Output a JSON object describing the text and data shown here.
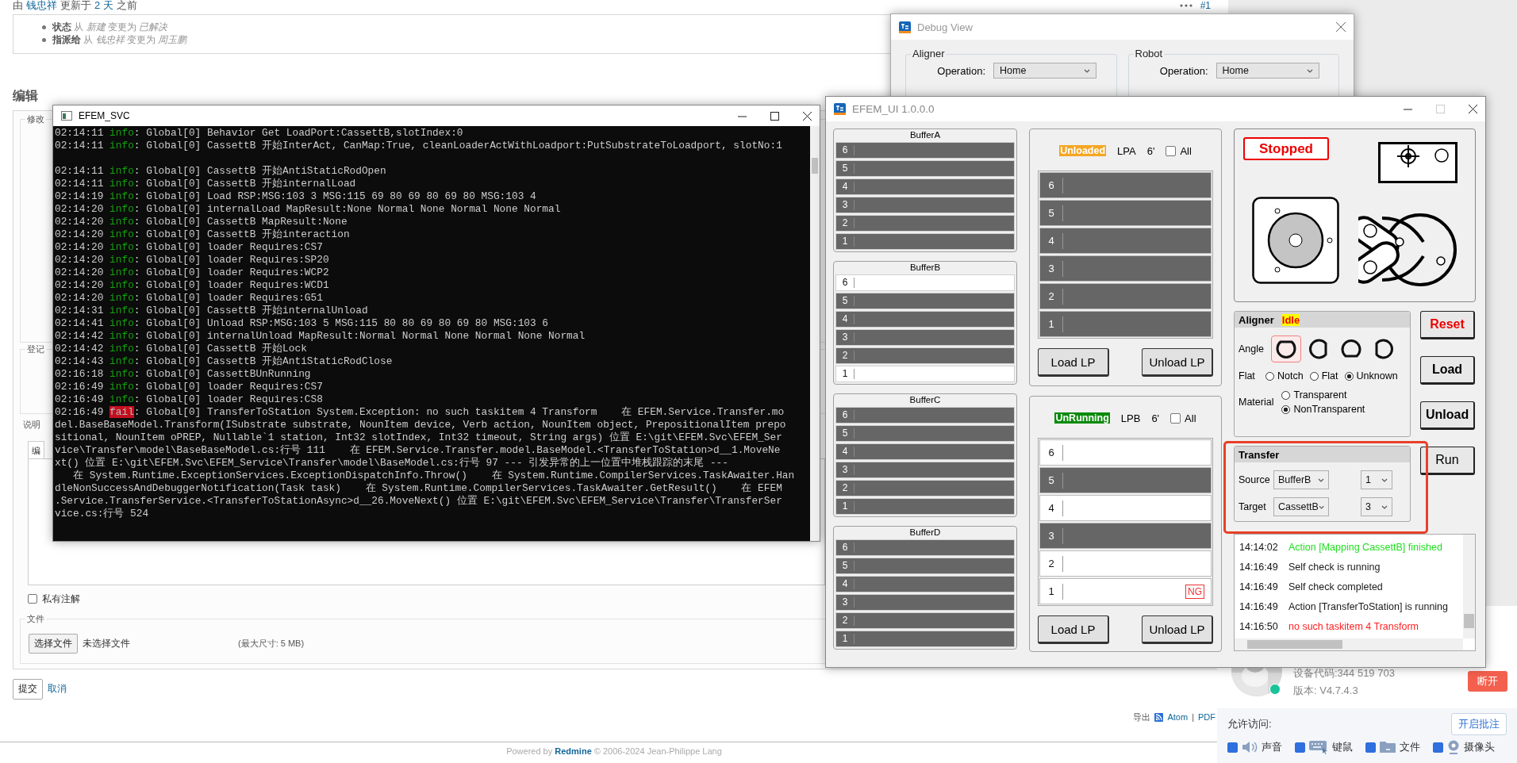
{
  "page": {
    "journal": {
      "header": [
        {
          "text": "由",
          "link": false
        },
        {
          "text": "钱忠祥",
          "link": true
        },
        {
          "text": "更新于",
          "link": false
        },
        {
          "text": "2 天",
          "link": true
        },
        {
          "text": "之前",
          "link": false
        }
      ],
      "number": "#1",
      "details": [
        "**状态** 从 *新建* 变更为 *已解决*",
        "**指派给** 从 *钱忠祥* 变更为 *周玉鹏*"
      ]
    },
    "edit_heading": "编辑",
    "form": {
      "fieldset_1": "修改",
      "fieldset_2": "登记",
      "description_label": "说明",
      "tab": "编",
      "private_note": {
        "label": "私有注解",
        "checked": false
      },
      "files": {
        "legend": "文件",
        "choose_button": "选择文件",
        "no_file": "未选择文件",
        "max_size": "(最大尺寸: 5 MB)"
      }
    },
    "actions": {
      "submit": "提交",
      "cancel": "取消"
    },
    "export": {
      "label": "导出",
      "links": [
        "Atom",
        "PDF"
      ],
      "separator": "|"
    },
    "footer": {
      "prefix": "Powered by",
      "link": "Redmine",
      "suffix": "© 2006-2024 Jean-Philippe Lang"
    }
  },
  "console_window": {
    "title": "EFEM_SVC",
    "lines": [
      {
        "kind": "log",
        "time": "02:14:11",
        "level": "info",
        "text": ": Global[0] Behavior Get LoadPort:CassettB,slotIndex:0"
      },
      {
        "kind": "log",
        "time": "02:14:11",
        "level": "info",
        "text": ": Global[0] CassettB 开始InterAct, CanMap:True, cleanLoaderActWithLoadport:PutSubstrateToLoadport, slotNo:1"
      },
      {
        "kind": "blank"
      },
      {
        "kind": "log",
        "time": "02:14:11",
        "level": "info",
        "text": ": Global[0] CassettB 开始AntiStaticRodOpen"
      },
      {
        "kind": "log",
        "time": "02:14:11",
        "level": "info",
        "text": ": Global[0] CassettB 开始internalLoad"
      },
      {
        "kind": "log",
        "time": "02:14:19",
        "level": "info",
        "text": ": Global[0] Load RSP:MSG:103 3 MSG:115 69 80 69 80 69 80 MSG:103 4"
      },
      {
        "kind": "log",
        "time": "02:14:20",
        "level": "info",
        "text": ": Global[0] internalLoad MapResult:None Normal None Normal None Normal"
      },
      {
        "kind": "log",
        "time": "02:14:20",
        "level": "info",
        "text": ": Global[0] CassettB MapResult:None"
      },
      {
        "kind": "log",
        "time": "02:14:20",
        "level": "info",
        "text": ": Global[0] CassettB 开始interaction"
      },
      {
        "kind": "log",
        "time": "02:14:20",
        "level": "info",
        "text": ": Global[0] loader Requires:CS7"
      },
      {
        "kind": "log",
        "time": "02:14:20",
        "level": "info",
        "text": ": Global[0] loader Requires:SP20"
      },
      {
        "kind": "log",
        "time": "02:14:20",
        "level": "info",
        "text": ": Global[0] loader Requires:WCP2"
      },
      {
        "kind": "log",
        "time": "02:14:20",
        "level": "info",
        "text": ": Global[0] loader Requires:WCD1"
      },
      {
        "kind": "log",
        "time": "02:14:20",
        "level": "info",
        "text": ": Global[0] loader Requires:G51"
      },
      {
        "kind": "log",
        "time": "02:14:31",
        "level": "info",
        "text": ": Global[0] CassettB 开始internalUnload"
      },
      {
        "kind": "log",
        "time": "02:14:41",
        "level": "info",
        "text": ": Global[0] Unload RSP:MSG:103 5 MSG:115 80 80 69 80 69 80 MSG:103 6"
      },
      {
        "kind": "log",
        "time": "02:14:42",
        "level": "info",
        "text": ": Global[0] internalUnload MapResult:Normal Normal None Normal None Normal"
      },
      {
        "kind": "log",
        "time": "02:14:42",
        "level": "info",
        "text": ": Global[0] CassettB 开始Lock"
      },
      {
        "kind": "log",
        "time": "02:14:43",
        "level": "info",
        "text": ": Global[0] CassettB 开始AntiStaticRodClose"
      },
      {
        "kind": "log",
        "time": "02:16:18",
        "level": "info",
        "text": ": Global[0] CassettBUnRunning"
      },
      {
        "kind": "log",
        "time": "02:16:49",
        "level": "info",
        "text": ": Global[0] loader Requires:CS7"
      },
      {
        "kind": "log",
        "time": "02:16:49",
        "level": "info",
        "text": ": Global[0] loader Requires:CS8"
      },
      {
        "kind": "log",
        "time": "02:16:49",
        "level": "fail",
        "text": ": Global[0] TransferToStation System.Exception: no such taskitem 4 Transform    在 EFEM.Service.Transfer.mo"
      },
      {
        "kind": "wrap",
        "text": "del.BaseBaseModel.Transform(ISubstrate substrate, NounItem device, Verb action, NounItem object, PrepositionalItem prepo"
      },
      {
        "kind": "wrap",
        "text": "sitional, NounItem oPREP, Nullable`1 station, Int32 slotIndex, Int32 timeout, String args) 位置 E:\\git\\EFEM.Svc\\EFEM_Ser"
      },
      {
        "kind": "wrap",
        "text": "vice\\Transfer\\model\\BaseBaseModel.cs:行号 111    在 EFEM.Service.Transfer.model.BaseModel.<TransferToStation>d__1.MoveNe"
      },
      {
        "kind": "wrap",
        "text": "xt() 位置 E:\\git\\EFEM.Svc\\EFEM_Service\\Transfer\\model\\BaseModel.cs:行号 97 --- 引发异常的上一位置中堆栈跟踪的末尾 ---"
      },
      {
        "kind": "wrap",
        "text": "   在 System.Runtime.ExceptionServices.ExceptionDispatchInfo.Throw()    在 System.Runtime.CompilerServices.TaskAwaiter.Han"
      },
      {
        "kind": "wrap",
        "text": "dleNonSuccessAndDebuggerNotification(Task task)    在 System.Runtime.CompilerServices.TaskAwaiter.GetResult()    在 EFEM"
      },
      {
        "kind": "wrap",
        "text": ".Service.TransferService.<TransferToStationAsync>d__26.MoveNext() 位置 E:\\git\\EFEM.Svc\\EFEM_Service\\Transfer\\TransferSer"
      },
      {
        "kind": "wrap",
        "text": "vice.cs:行号 524"
      }
    ]
  },
  "debug_window": {
    "title": "Debug View",
    "groups": [
      {
        "title": "Aligner",
        "fields": [
          {
            "label": "Operation:",
            "value": "Home"
          }
        ]
      },
      {
        "title": "Robot",
        "fields": [
          {
            "label": "Operation:",
            "value": "Home"
          }
        ]
      }
    ]
  },
  "efem_window": {
    "title": "EFEM_UI 1.0.0.0",
    "buffers": [
      {
        "name": "BufferA",
        "slots": [
          {
            "label": "6",
            "occupied": true
          },
          {
            "label": "5",
            "occupied": true
          },
          {
            "label": "4",
            "occupied": true
          },
          {
            "label": "3",
            "occupied": true
          },
          {
            "label": "2",
            "occupied": true
          },
          {
            "label": "1",
            "occupied": true
          }
        ]
      },
      {
        "name": "BufferB",
        "slots": [
          {
            "label": "6",
            "occupied": false
          },
          {
            "label": "5",
            "occupied": true
          },
          {
            "label": "4",
            "occupied": true
          },
          {
            "label": "3",
            "occupied": true
          },
          {
            "label": "2",
            "occupied": true
          },
          {
            "label": "1",
            "occupied": false
          }
        ]
      },
      {
        "name": "BufferC",
        "slots": [
          {
            "label": "6",
            "occupied": true
          },
          {
            "label": "5",
            "occupied": true
          },
          {
            "label": "4",
            "occupied": true
          },
          {
            "label": "3",
            "occupied": true
          },
          {
            "label": "2",
            "occupied": true
          },
          {
            "label": "1",
            "occupied": true
          }
        ]
      },
      {
        "name": "BufferD",
        "slots": [
          {
            "label": "6",
            "occupied": true
          },
          {
            "label": "5",
            "occupied": true
          },
          {
            "label": "4",
            "occupied": true
          },
          {
            "label": "3",
            "occupied": true
          },
          {
            "label": "2",
            "occupied": true
          },
          {
            "label": "1",
            "occupied": true
          }
        ]
      }
    ],
    "load_ports": [
      {
        "status": "Unloaded",
        "color": "#f5a623",
        "name": "LPA",
        "size": "6'",
        "all": {
          "label": "All",
          "checked": false
        },
        "slots": [
          {
            "label": "6",
            "occupied": true
          },
          {
            "label": "5",
            "occupied": true
          },
          {
            "label": "4",
            "occupied": true
          },
          {
            "label": "3",
            "occupied": true
          },
          {
            "label": "2",
            "occupied": true
          },
          {
            "label": "1",
            "occupied": true
          }
        ],
        "buttons": [
          "Load LP",
          "Unload LP"
        ]
      },
      {
        "status": "UnRunning",
        "color": "#0a8a0a",
        "name": "LPB",
        "size": "6'",
        "all": {
          "label": "All",
          "checked": false
        },
        "slots": [
          {
            "label": "6",
            "occupied": false
          },
          {
            "label": "5",
            "occupied": true
          },
          {
            "label": "4",
            "occupied": false
          },
          {
            "label": "3",
            "occupied": true
          },
          {
            "label": "2",
            "occupied": false
          },
          {
            "label": "1",
            "occupied": false,
            "tag": "NG"
          }
        ],
        "buttons": [
          "Load LP",
          "Unload LP"
        ]
      }
    ],
    "status": "Stopped",
    "aligner": {
      "title": "Aligner",
      "state": "Idle",
      "angle": {
        "label": "Angle",
        "options": [
          {
            "kind": "top",
            "selected": true
          },
          {
            "kind": "right",
            "selected": false
          },
          {
            "kind": "bottom",
            "selected": false
          },
          {
            "kind": "left",
            "selected": false
          }
        ]
      },
      "flat": {
        "label": "Flat",
        "options": [
          {
            "label": "Notch",
            "selected": false
          },
          {
            "label": "Flat",
            "selected": false
          },
          {
            "label": "Unknown",
            "selected": true
          }
        ]
      },
      "material": {
        "label": "Material",
        "options": [
          {
            "label": "Transparent",
            "selected": false
          },
          {
            "label": "NonTransparent",
            "selected": true
          }
        ]
      }
    },
    "actions": [
      {
        "label": "Reset",
        "kind": "danger"
      },
      {
        "label": "Load",
        "kind": "bold"
      },
      {
        "label": "Unload",
        "kind": "bold"
      },
      {
        "label": "Run",
        "kind": "normal"
      }
    ],
    "transfer": {
      "title": "Transfer",
      "rows": [
        {
          "label": "Source",
          "location": "BufferB",
          "slot": "1"
        },
        {
          "label": "Target",
          "location": "CassettB",
          "slot": "3"
        }
      ]
    },
    "log": [
      {
        "time": "14:14:02",
        "message": "Action [Mapping CassettB] finished",
        "color": "#1ee01e"
      },
      {
        "time": "14:16:49",
        "message": "Self check is running",
        "color": "#1a1a1a"
      },
      {
        "time": "14:16:49",
        "message": "Self check completed",
        "color": "#1a1a1a"
      },
      {
        "time": "14:16:49",
        "message": "Action [TransferToStation] is running",
        "color": "#1a1a1a"
      },
      {
        "time": "14:16:50",
        "message": "no such taskitem 4 Transform",
        "color": "#ff2020"
      }
    ]
  },
  "remote_panel": {
    "device_code": "设备代码:344 519 703",
    "version": "版本: V4.7.4.3",
    "disconnect": "断开",
    "allow_label": "允许访问:",
    "annotate_button": "开启批注",
    "permissions": [
      {
        "label": "声音",
        "kind": "sound",
        "checked": true
      },
      {
        "label": "键鼠",
        "kind": "keyboard",
        "checked": true
      },
      {
        "label": "文件",
        "kind": "file",
        "checked": true
      },
      {
        "label": "摄像头",
        "kind": "camera",
        "checked": true
      }
    ]
  }
}
